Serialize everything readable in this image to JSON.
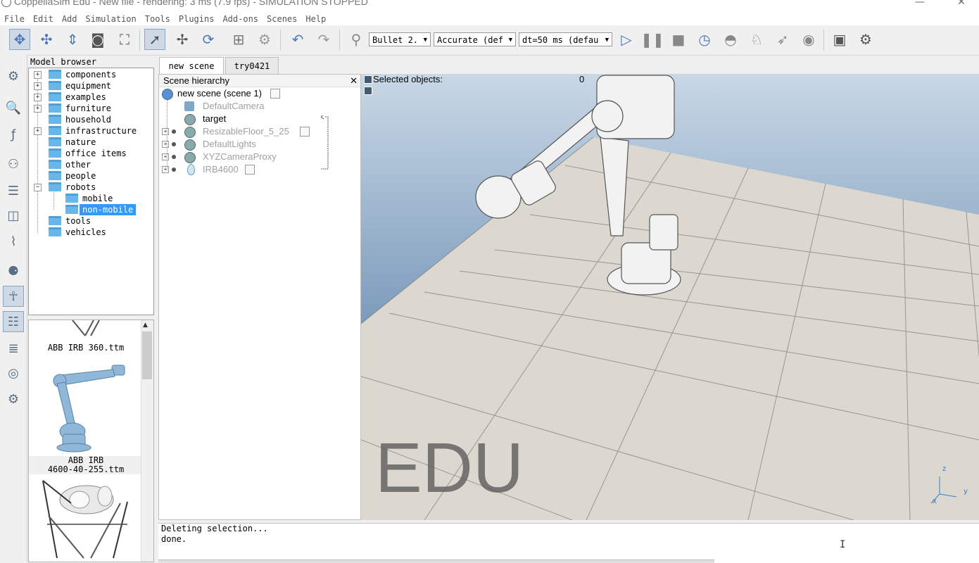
{
  "window": {
    "title": "CoppeliaSim Edu - New file - rendering: 3 ms (7.9 fps) - SIMULATION STOPPED",
    "minimize_glyph": "—",
    "close_glyph": "✕"
  },
  "menu": [
    "File",
    "Edit",
    "Add",
    "Simulation",
    "Tools",
    "Plugins",
    "Add-ons",
    "Scenes",
    "Help"
  ],
  "toolbar": {
    "engine": "Bullet 2.",
    "accuracy": "Accurate (def",
    "timestep": "dt=50 ms (defau",
    "icons": [
      "camera-pan-icon",
      "camera-rotate-icon",
      "camera-shift-icon",
      "camera-angle-icon",
      "fit-to-view-icon",
      "object-select-icon",
      "object-move-icon",
      "object-rotate-icon",
      "assemble-icon",
      "transfer-dna-icon",
      "undo-icon",
      "redo-icon",
      "dynamics-icon",
      "start-icon",
      "pause-icon",
      "stop-icon",
      "real-time-icon",
      "slow-down-icon",
      "speed-up-icon",
      "threaded-rendering-icon",
      "visualization-icon",
      "scene-page-icon",
      "scene-selector-icon"
    ]
  },
  "model_browser": {
    "title": "Model browser",
    "folders": [
      {
        "label": "components",
        "expandable": true
      },
      {
        "label": "equipment",
        "expandable": true
      },
      {
        "label": "examples",
        "expandable": true
      },
      {
        "label": "furniture",
        "expandable": true
      },
      {
        "label": "household",
        "expandable": false
      },
      {
        "label": "infrastructure",
        "expandable": true
      },
      {
        "label": "nature",
        "expandable": false
      },
      {
        "label": "office items",
        "expandable": false
      },
      {
        "label": "other",
        "expandable": false
      },
      {
        "label": "people",
        "expandable": false
      },
      {
        "label": "robots",
        "expandable": true,
        "expanded": true
      },
      {
        "label": "mobile",
        "child": true
      },
      {
        "label": "non-mobile",
        "child": true,
        "selected": true
      },
      {
        "label": "tools",
        "expandable": false
      },
      {
        "label": "vehicles",
        "expandable": false
      }
    ]
  },
  "thumbnails": [
    {
      "caption_1": "ABB IRB 360.ttm",
      "caption_2": ""
    },
    {
      "caption_1": "ABB IRB",
      "caption_2": "4600-40-255.ttm"
    }
  ],
  "tabs": [
    {
      "label": "new scene",
      "active": true
    },
    {
      "label": "try0421",
      "active": false
    }
  ],
  "scene_hierarchy": {
    "title": "Scene hierarchy",
    "close": "✕",
    "items": [
      {
        "label": "new scene (scene 1)",
        "dim": false
      },
      {
        "label": "DefaultCamera",
        "dim": true
      },
      {
        "label": "target",
        "dim": false
      },
      {
        "label": "ResizableFloor_5_25",
        "dim": true
      },
      {
        "label": "DefaultLights",
        "dim": true
      },
      {
        "label": "XYZCameraProxy",
        "dim": true
      },
      {
        "label": "IRB4600",
        "dim": true
      }
    ]
  },
  "viewport": {
    "selected_label": "Selected objects:",
    "selected_count": "0",
    "watermark": "EDU",
    "axis_z": "z",
    "axis_y": "y",
    "axis_x": "x"
  },
  "console": {
    "lines": [
      "Deleting selection...",
      "done."
    ]
  }
}
